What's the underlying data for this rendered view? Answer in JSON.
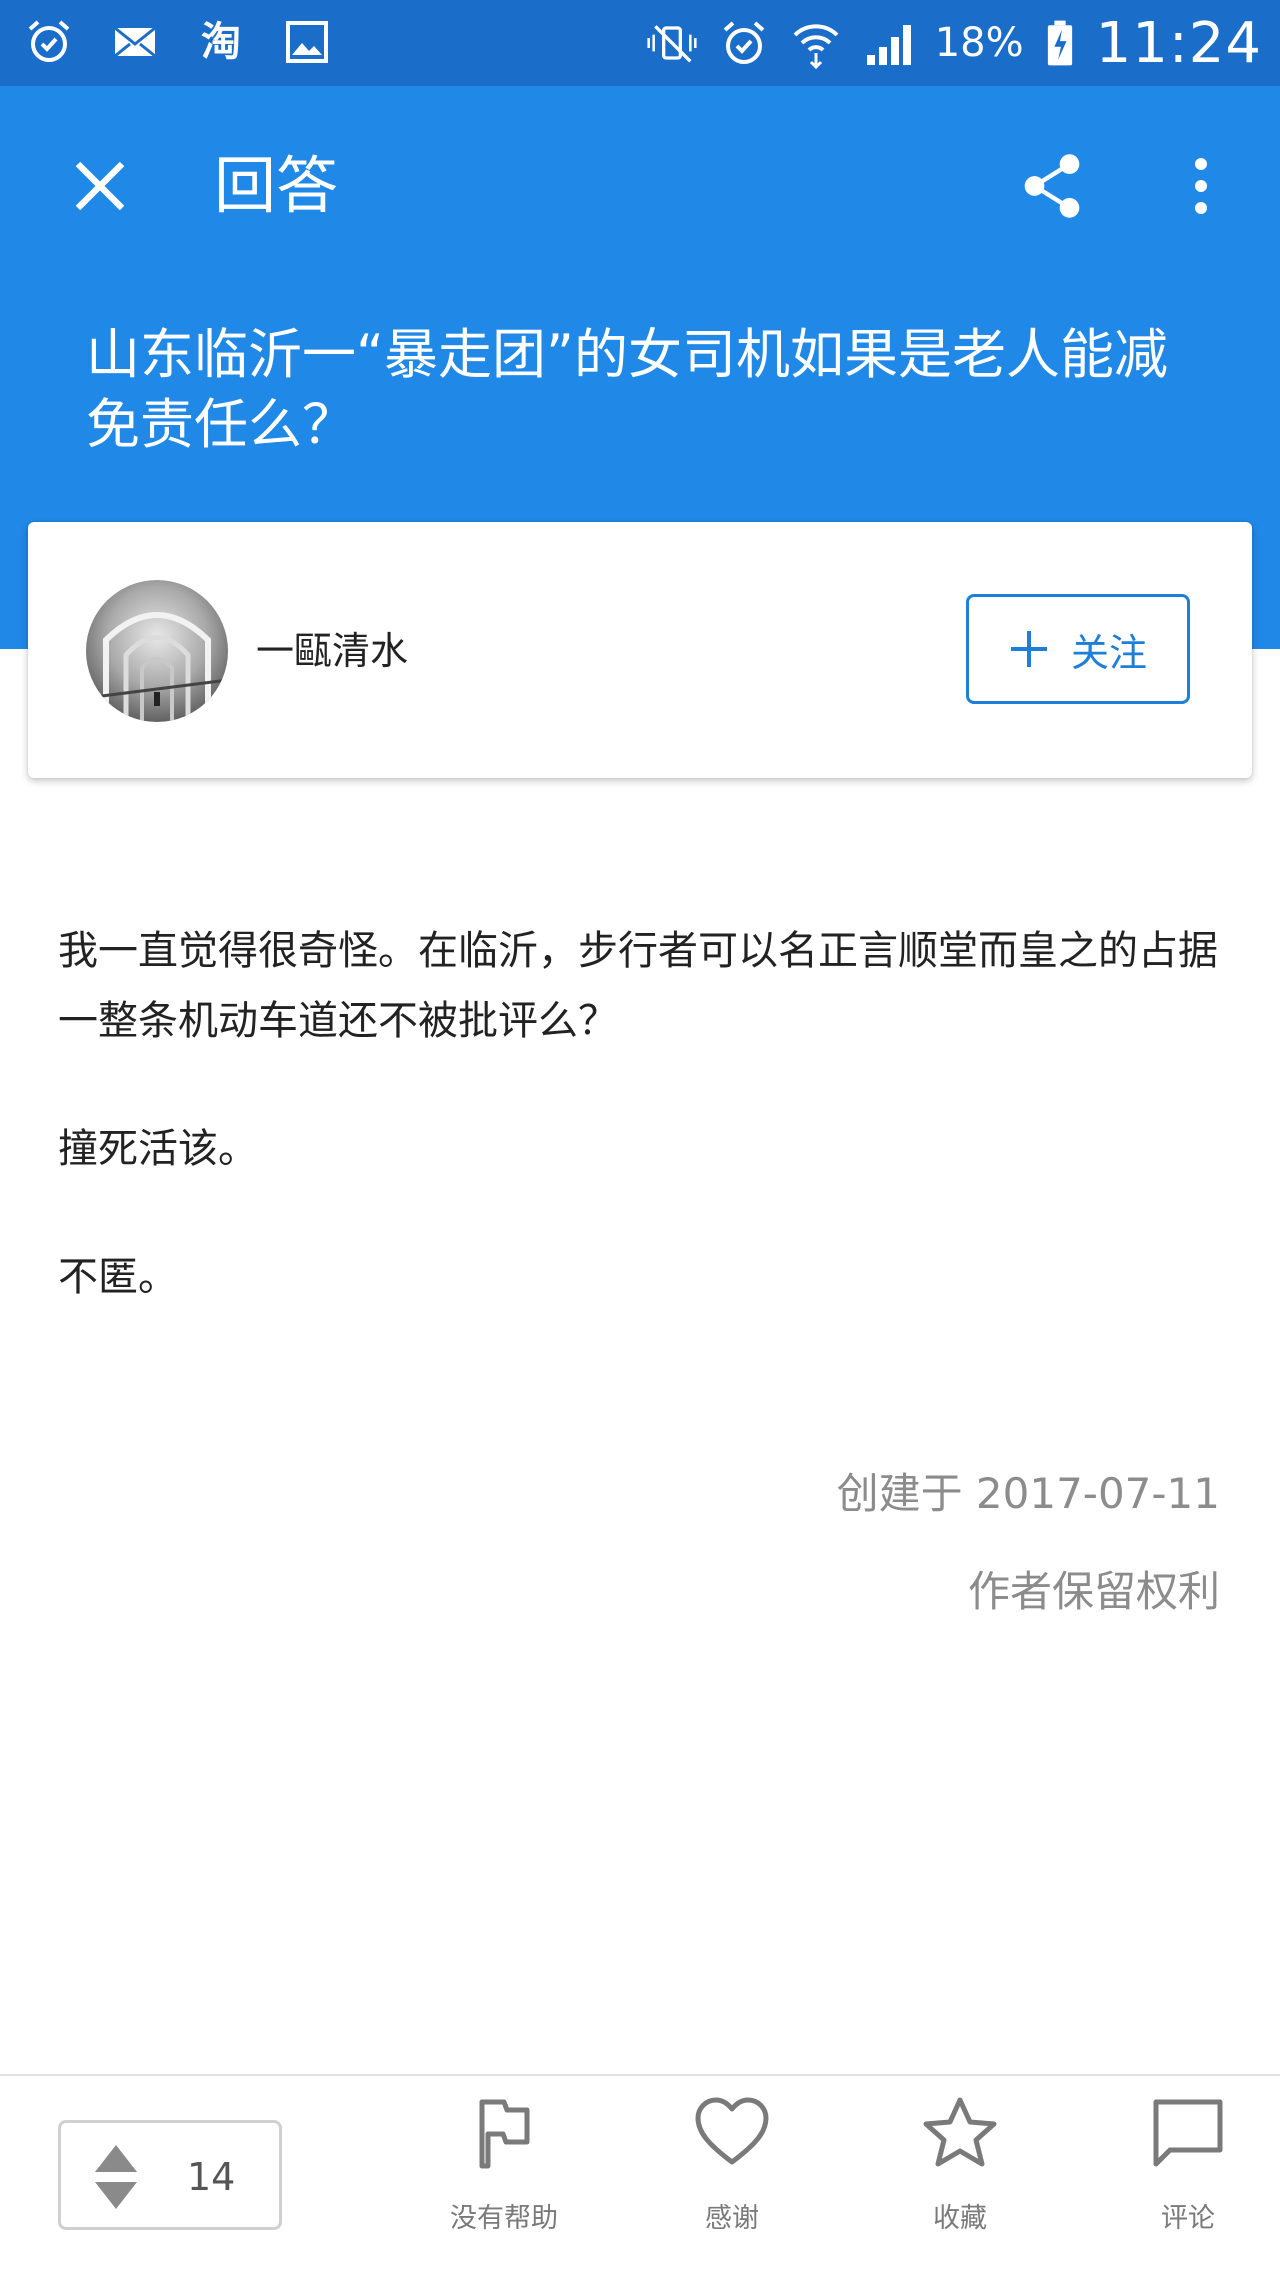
{
  "status_bar": {
    "left_icons": [
      "alarm-icon",
      "mail-icon",
      "taobao-icon",
      "image-icon"
    ],
    "taobao_text": "淘",
    "right_icons": [
      "vibrate-mute-icon",
      "alarm-icon",
      "wifi-icon",
      "signal-icon",
      "battery-charging-icon"
    ],
    "battery_percent": "18%",
    "time": "11:24",
    "background": "#1a6dc9"
  },
  "app_bar": {
    "title": "回答",
    "close_icon": "close-icon",
    "share_icon": "share-icon",
    "more_icon": "more-vert-icon",
    "background": "#2088e6"
  },
  "question": {
    "title": "山东临沂一“暴走团”的女司机如果是老人能减免责任么？"
  },
  "author": {
    "name": "一甌清水",
    "follow_label": "关注",
    "follow_icon": "plus-icon",
    "accent": "#1e7fd9"
  },
  "answer": {
    "paragraphs": [
      "我一直觉得很奇怪。在临沂，步行者可以名正言顺堂而皇之的占据一整条机动车道还不被批评么？",
      "撞死活该。",
      "不匿。"
    ],
    "created": "创建于 2017-07-11",
    "rights": "作者保留权利"
  },
  "bottom_bar": {
    "vote_count": "14",
    "actions": [
      {
        "label": "没有帮助",
        "icon": "flag-icon"
      },
      {
        "label": "感谢",
        "icon": "heart-icon"
      },
      {
        "label": "收藏",
        "icon": "star-icon"
      },
      {
        "label": "评论",
        "icon": "comment-icon"
      }
    ]
  }
}
